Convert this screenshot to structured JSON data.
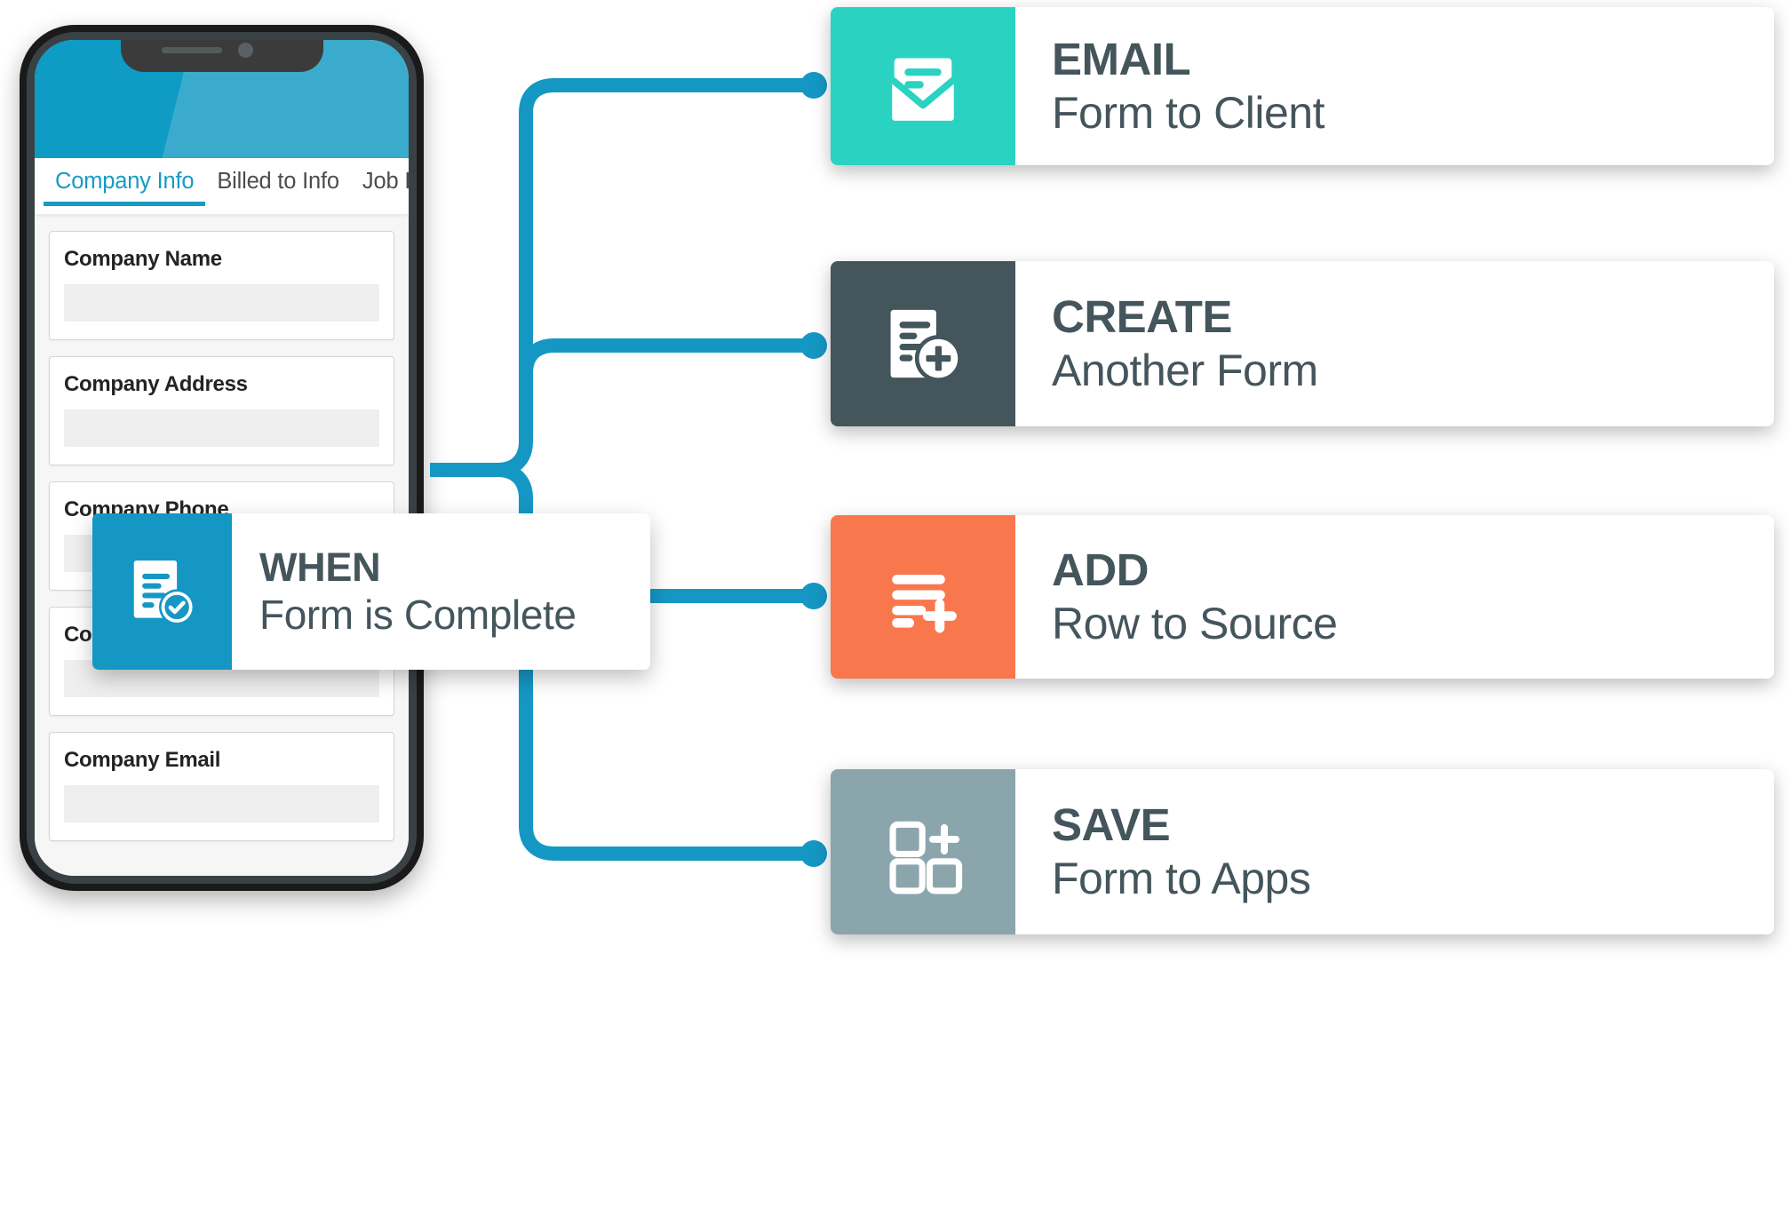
{
  "phone": {
    "tabs": [
      {
        "label": "Company Info",
        "active": true
      },
      {
        "label": "Billed to Info",
        "active": false
      },
      {
        "label": "Job Info",
        "active": false
      }
    ],
    "fields": [
      {
        "label": "Company Name",
        "value": ""
      },
      {
        "label": "Company Address",
        "value": ""
      },
      {
        "label": "Company Phone",
        "value": ""
      },
      {
        "label": "Company Contact",
        "value": ""
      },
      {
        "label": "Company Email",
        "value": ""
      }
    ],
    "header_color": "#3aabcd",
    "header_accent_color": "#0e9bc4",
    "active_tab_color": "#179bc4"
  },
  "trigger": {
    "title": "WHEN",
    "subtitle": "Form is Complete",
    "icon": "document-check-icon",
    "icon_bg": "#1597c4",
    "text_color": "#44555c"
  },
  "connector": {
    "color": "#1597c4",
    "endpoint_shape": "dot"
  },
  "actions": [
    {
      "title": "EMAIL",
      "subtitle": "Form to Client",
      "icon": "envelope-document-icon",
      "icon_bg": "#2ad2c2"
    },
    {
      "title": "CREATE",
      "subtitle": "Another Form",
      "icon": "document-plus-icon",
      "icon_bg": "#44555c"
    },
    {
      "title": "ADD",
      "subtitle": "Row to Source",
      "icon": "list-plus-icon",
      "icon_bg": "#f9774c"
    },
    {
      "title": "SAVE",
      "subtitle": "Form to Apps",
      "icon": "grid-plus-icon",
      "icon_bg": "#8ba5ac"
    }
  ]
}
